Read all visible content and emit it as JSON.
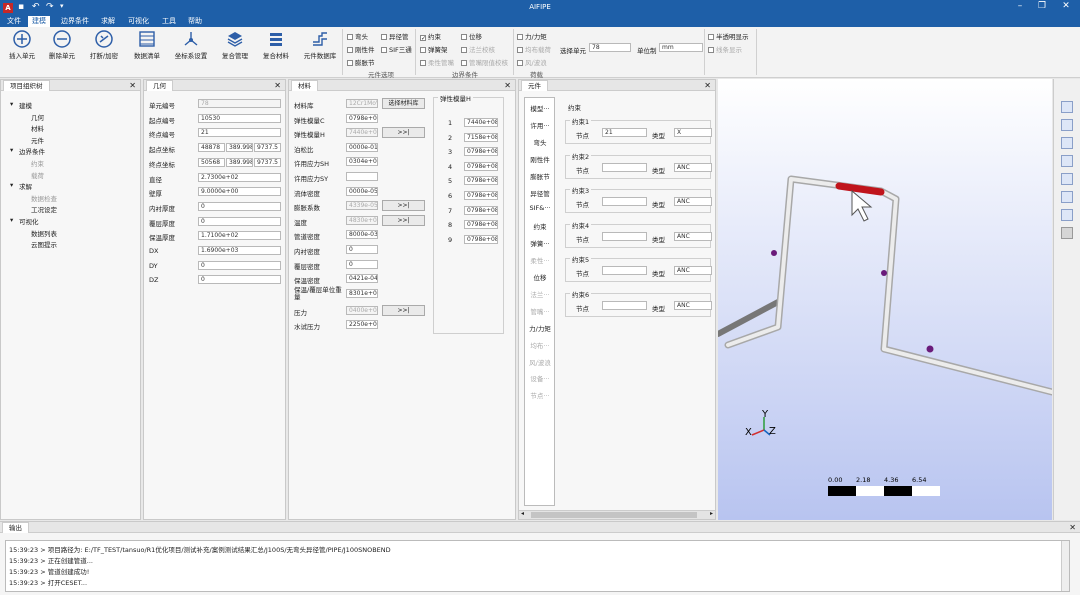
{
  "app_title": "AIFIPE",
  "menu": [
    "文件",
    "建模",
    "边界条件",
    "求解",
    "可视化",
    "工具",
    "帮助"
  ],
  "ribbon": {
    "buttons": [
      "插入单元",
      "删除单元",
      "打断/加密",
      "数据清单",
      "坐标系设置",
      "复合管理",
      "复合材料",
      "元件数据库"
    ],
    "component_options": [
      {
        "label": "弯头",
        "checked": false,
        "disabled": false
      },
      {
        "label": "异径管",
        "checked": false,
        "disabled": false
      },
      {
        "label": "刚性件",
        "checked": false,
        "disabled": false
      },
      {
        "label": "SIF三通",
        "checked": false,
        "disabled": false
      },
      {
        "label": "膨胀节",
        "checked": false,
        "disabled": false
      }
    ],
    "component_group_label": "元件选项",
    "boundary_options": [
      {
        "label": "约束",
        "checked": true,
        "disabled": false
      },
      {
        "label": "位移",
        "checked": false,
        "disabled": false
      },
      {
        "label": "弹簧架",
        "checked": false,
        "disabled": false
      },
      {
        "label": "法兰校核",
        "checked": false,
        "disabled": true
      },
      {
        "label": "柔性管嘴",
        "checked": false,
        "disabled": true
      },
      {
        "label": "管嘴限值校核",
        "checked": false,
        "disabled": true
      }
    ],
    "boundary_group_label": "边界条件",
    "load_options": [
      {
        "label": "力/力矩",
        "checked": false,
        "disabled": false
      },
      {
        "label": "均布载荷",
        "checked": false,
        "disabled": true
      },
      {
        "label": "风/波浪",
        "checked": false,
        "disabled": true
      }
    ],
    "load_group_label": "荷载",
    "select_unit_label": "选择单元",
    "select_unit_value": "78",
    "unit_system_label": "单位制",
    "unit_system_value": "mm",
    "view_options": [
      {
        "label": "半透明显示",
        "checked": false,
        "disabled": false
      },
      {
        "label": "线条显示",
        "checked": false,
        "disabled": true
      }
    ]
  },
  "project_tree": {
    "title": "项目组织树",
    "items": [
      {
        "label": "建模",
        "level": 0,
        "disabled": false
      },
      {
        "label": "几何",
        "level": 1,
        "disabled": false
      },
      {
        "label": "材料",
        "level": 1,
        "disabled": false
      },
      {
        "label": "元件",
        "level": 1,
        "disabled": false
      },
      {
        "label": "边界条件",
        "level": 0,
        "disabled": false
      },
      {
        "label": "约束",
        "level": 1,
        "disabled": true
      },
      {
        "label": "载荷",
        "level": 1,
        "disabled": true
      },
      {
        "label": "求解",
        "level": 0,
        "disabled": false
      },
      {
        "label": "数据检查",
        "level": 1,
        "disabled": true
      },
      {
        "label": "工况设定",
        "level": 1,
        "disabled": false
      },
      {
        "label": "可视化",
        "level": 0,
        "disabled": false
      },
      {
        "label": "数据列表",
        "level": 1,
        "disabled": false
      },
      {
        "label": "云图提示",
        "level": 1,
        "disabled": false
      }
    ]
  },
  "geometry": {
    "title": "几何",
    "rows": [
      {
        "label": "单元编号",
        "values": [
          "78"
        ],
        "disabled": true
      },
      {
        "label": "起点编号",
        "values": [
          "10530"
        ]
      },
      {
        "label": "终点编号",
        "values": [
          "21"
        ]
      },
      {
        "label": "起点坐标",
        "values": [
          "48878",
          "389.998",
          "9737.5"
        ]
      },
      {
        "label": "终点坐标",
        "values": [
          "50568",
          "389.998",
          "9737.5"
        ]
      },
      {
        "label": "直径",
        "values": [
          "2.7300e+02"
        ]
      },
      {
        "label": "壁厚",
        "values": [
          "9.0000e+00"
        ]
      },
      {
        "label": "内衬厚度",
        "values": [
          "0"
        ]
      },
      {
        "label": "覆层厚度",
        "values": [
          "0"
        ]
      },
      {
        "label": "保温厚度",
        "values": [
          "1.7100e+02"
        ]
      },
      {
        "label": "DX",
        "values": [
          "1.6900e+03"
        ]
      },
      {
        "label": "DY",
        "values": [
          "0"
        ]
      },
      {
        "label": "DZ",
        "values": [
          "0"
        ]
      }
    ]
  },
  "material": {
    "title": "材料",
    "rows": [
      {
        "label": "材料库",
        "value": "12Cr1MoVG",
        "disabled": true,
        "button": "选择材料库"
      },
      {
        "label": "弹性模量C",
        "value": "0798e+08",
        "disabled": false
      },
      {
        "label": "弹性模量H",
        "value": "7440e+08",
        "disabled": true,
        "button": ">>|"
      },
      {
        "label": "泊松比",
        "value": "0000e-01",
        "disabled": false
      },
      {
        "label": "许用应力SH",
        "value": "0304e+05",
        "disabled": false
      },
      {
        "label": "许用应力SY",
        "value": "",
        "disabled": false
      },
      {
        "label": "流体密度",
        "value": "0000e-05",
        "disabled": false
      },
      {
        "label": "膨胀系数",
        "value": "4339e-05",
        "disabled": true,
        "button": ">>|"
      },
      {
        "label": "温度",
        "value": "4830e+02",
        "disabled": true,
        "button": ">>|"
      },
      {
        "label": "管道密度",
        "value": "8000e-03",
        "disabled": false
      },
      {
        "label": "内衬密度",
        "value": "0",
        "disabled": false
      },
      {
        "label": "覆层密度",
        "value": "0",
        "disabled": false
      },
      {
        "label": "保温密度",
        "value": "0421e-04",
        "disabled": false
      },
      {
        "label": "保温/覆层单位重量",
        "value": "8301e+00",
        "disabled": false
      },
      {
        "label": "压力",
        "value": "0400e+03",
        "disabled": true,
        "button": ">>|"
      },
      {
        "label": "水试压力",
        "value": "2250e+03",
        "disabled": false
      }
    ],
    "modulus_group_title": "弹性模量H",
    "modulus_list": [
      {
        "idx": "1",
        "value": "7440e+08"
      },
      {
        "idx": "2",
        "value": "7158e+08"
      },
      {
        "idx": "3",
        "value": "0798e+08"
      },
      {
        "idx": "4",
        "value": "0798e+08"
      },
      {
        "idx": "5",
        "value": "0798e+08"
      },
      {
        "idx": "6",
        "value": "0798e+08"
      },
      {
        "idx": "7",
        "value": "0798e+08"
      },
      {
        "idx": "8",
        "value": "0798e+08"
      },
      {
        "idx": "9",
        "value": "0798e+08"
      }
    ]
  },
  "element": {
    "title": "元件",
    "list": [
      {
        "label": "模型···",
        "disabled": false
      },
      {
        "label": "许用···",
        "disabled": false
      },
      {
        "label": "弯头",
        "disabled": false
      },
      {
        "label": "刚性件",
        "disabled": false
      },
      {
        "label": "膨胀节",
        "disabled": false
      },
      {
        "label": "异径管",
        "disabled": false
      },
      {
        "label": "SIF&···",
        "disabled": false
      },
      {
        "label": "约束",
        "disabled": false
      },
      {
        "label": "弹簧···",
        "disabled": false
      },
      {
        "label": "柔性···",
        "disabled": true
      },
      {
        "label": "位移",
        "disabled": false
      },
      {
        "label": "法兰···",
        "disabled": true
      },
      {
        "label": "管嘴···",
        "disabled": true
      },
      {
        "label": "力/力矩",
        "disabled": false
      },
      {
        "label": "均布···",
        "disabled": true
      },
      {
        "label": "风/波浪",
        "disabled": true
      },
      {
        "label": "设备···",
        "disabled": true
      },
      {
        "label": "节点···",
        "disabled": true
      }
    ],
    "constraint_title": "约束",
    "node_label": "节点",
    "type_label": "类型",
    "constraints": [
      {
        "name": "约束1",
        "node": "21",
        "type": "X"
      },
      {
        "name": "约束2",
        "node": "",
        "type": "ANC"
      },
      {
        "name": "约束3",
        "node": "",
        "type": "ANC"
      },
      {
        "name": "约束4",
        "node": "",
        "type": "ANC"
      },
      {
        "name": "约束5",
        "node": "",
        "type": "ANC"
      },
      {
        "name": "约束6",
        "node": "",
        "type": "ANC"
      }
    ]
  },
  "viewport": {
    "axis_x": "X",
    "axis_y": "Y",
    "axis_z": "Z",
    "scale_labels": [
      "0.00",
      "2.18",
      "4.36",
      "6.54"
    ]
  },
  "output": {
    "title": "输出",
    "lines": [
      "15:39:23 > 项目路径为: E:/TF_TEST/tansuo/R1优化项目/测试补充/案例测试结果汇总/J100S/无弯头异径管/PIPE/J100SNOBEND",
      "15:39:23 > 正在创建管道...",
      "15:39:23 > 管道创建成功!",
      "15:39:23 > 打开CESET..."
    ]
  },
  "colors": {
    "brand": "#1e5fa8",
    "highlight": "#c0141c",
    "pipe": "#d8d8d8"
  }
}
